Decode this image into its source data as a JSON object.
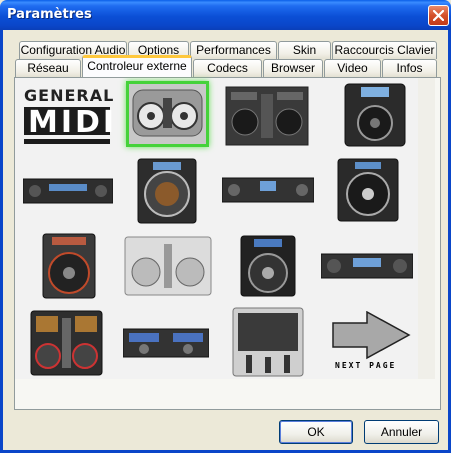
{
  "window": {
    "title": "Paramètres"
  },
  "tabs_back_row": [
    "Configuration Audio",
    "Options",
    "Performances",
    "Skin",
    "Raccourcis Clavier"
  ],
  "tabs_front_row": [
    "Réseau",
    "Controleur externe",
    "Codecs",
    "Browser",
    "Video",
    "Infos"
  ],
  "active_tab": "Controleur externe",
  "controllers": {
    "midi_logo": {
      "line1": "GENERAL",
      "line2": "MIDI"
    },
    "next_page": "NEXT PAGE",
    "selected_index": 1,
    "icons": [
      "general-midi",
      "hercules-dj-console",
      "denon-dn-hc4500",
      "denon-dn-hc1000s",
      "rack-cd-player",
      "numark-cdx",
      "denon-dn-d4500",
      "denon-dn-s3500",
      "pioneer-cdj",
      "vestax-vci-100",
      "numark-icdx",
      "denon-dn-d9000",
      "vestax-vci-300",
      "american-audio-ck",
      "allen-heath-xone",
      "next-page-arrow"
    ]
  },
  "buttons": {
    "ok": "OK",
    "cancel": "Annuler"
  },
  "colors": {
    "titlebar": "#0a46c9",
    "selection": "#45d23a",
    "panel": "#f2f2f2",
    "active_tab_accent": "#ffc83c"
  }
}
